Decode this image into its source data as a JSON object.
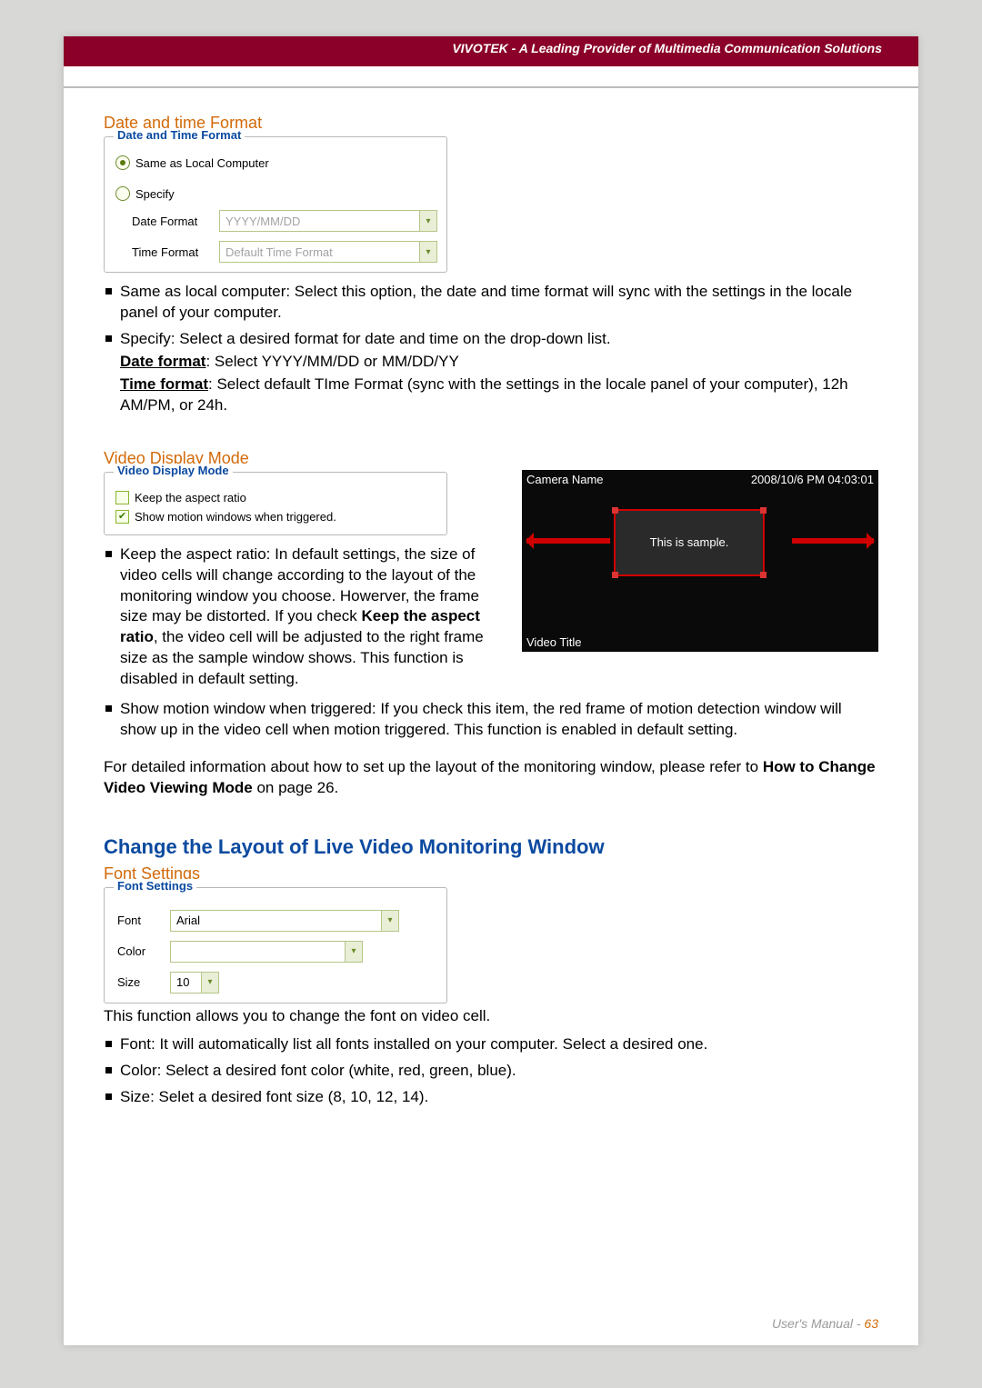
{
  "header": {
    "brand": "VIVOTEK - A Leading Provider of Multimedia Communication Solutions"
  },
  "date_section": {
    "title": "Date and time Format",
    "legend": "Date and Time Format",
    "radio_same": "Same as Local Computer",
    "radio_specify": "Specify",
    "date_label": "Date Format",
    "date_value": "YYYY/MM/DD",
    "time_label": "Time Format",
    "time_value": "Default Time Format",
    "bullets": {
      "b1": "Same as local computer: Select this option, the date and time format will sync with the settings in the locale panel of your computer.",
      "b2_lead": "Specify: Select a desired format for date and time on the drop-down list.",
      "b2_date_u": "Date format",
      "b2_date_rest": ": Select YYYY/MM/DD or MM/DD/YY",
      "b2_time_u": "Time format",
      "b2_time_rest": ": Select default TIme Format (sync with the settings in the locale panel of your computer), 12h AM/PM, or 24h."
    }
  },
  "video_section": {
    "title": "Video Display Mode",
    "legend": "Video Display Mode",
    "cb_aspect": "Keep the aspect ratio",
    "cb_motion": "Show motion windows when triggered.",
    "sample": {
      "camera_name": "Camera Name",
      "timestamp": "2008/10/6 PM 04:03:01",
      "center": "This is sample.",
      "video_title": "Video Title"
    },
    "bullets": {
      "b1a": "Keep the aspect ratio: In default settings, the size of video cells will change according to the layout of the monitoring window you choose. Howerver, the frame size may be distorted. If you check ",
      "b1b": "Keep the aspect ratio",
      "b1c": ", the video cell will be adjusted to the right frame size as the sample window shows. This function is disabled in default setting.",
      "b2": "Show motion window when triggered: If you check this item, the red frame of motion detection window will show up in the video cell when motion triggered. This function is enabled in default setting."
    },
    "para_a": "For detailed information about how to set up the layout of the monitoring window, please refer to ",
    "para_b": "How to Change Video Viewing Mode",
    "para_c": " on page 26."
  },
  "layout_heading": "Change the Layout of Live Video Monitoring Window",
  "font_section": {
    "title": "Font Settings",
    "legend": "Font Settings",
    "font_label": "Font",
    "font_value": "Arial",
    "color_label": "Color",
    "color_value": "",
    "size_label": "Size",
    "size_value": "10",
    "intro": "This function allows you to change the font on video cell.",
    "bullets": {
      "b1": "Font: It will automatically list all fonts installed on your computer. Select a desired one.",
      "b2": "Color: Select a desired font color (white, red, green, blue).",
      "b3": "Size: Selet a desired font size (8, 10, 12, 14)."
    }
  },
  "footer": {
    "label": "User's Manual - ",
    "page": "63"
  }
}
